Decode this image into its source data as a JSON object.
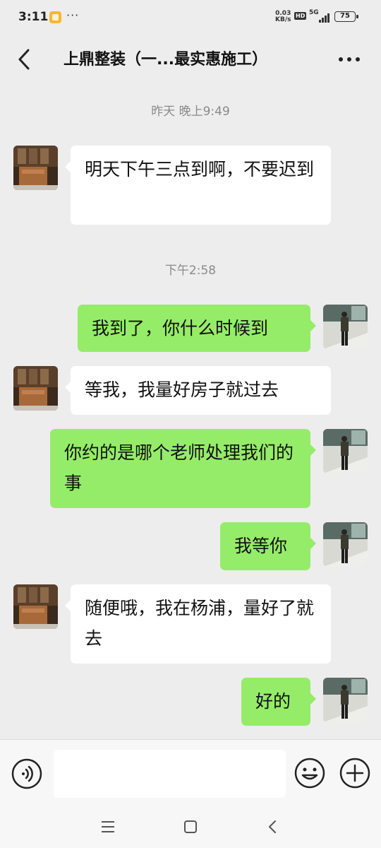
{
  "status_bar": {
    "time": "3:11",
    "network_speed_value": "0.03",
    "network_speed_unit": "KB/s",
    "hd_label": "HD",
    "signal_label": "5G",
    "battery": "75"
  },
  "header": {
    "title": "上鼎整装（一...最实惠施工）"
  },
  "timestamps": [
    "昨天 晚上9:49",
    "下午2:58"
  ],
  "messages": [
    {
      "sender": "other",
      "text": "明天下午三点到啊，不要迟到"
    },
    {
      "sender": "self",
      "text": "我到了，你什么时候到"
    },
    {
      "sender": "other",
      "text": "等我，我量好房子就过去"
    },
    {
      "sender": "self",
      "text": "你约的是哪个老师处理我们的事"
    },
    {
      "sender": "self",
      "text": "我等你"
    },
    {
      "sender": "other",
      "text": "随便哦，我在杨浦，量好了就去"
    },
    {
      "sender": "self",
      "text": "好的"
    }
  ],
  "input_bar": {
    "placeholder": "",
    "voice_icon": "voice-icon",
    "emoji_icon": "emoji-icon",
    "plus_icon": "plus-icon"
  },
  "colors": {
    "background": "#ededed",
    "bubble_self": "#95ec69",
    "bubble_other": "#ffffff"
  }
}
